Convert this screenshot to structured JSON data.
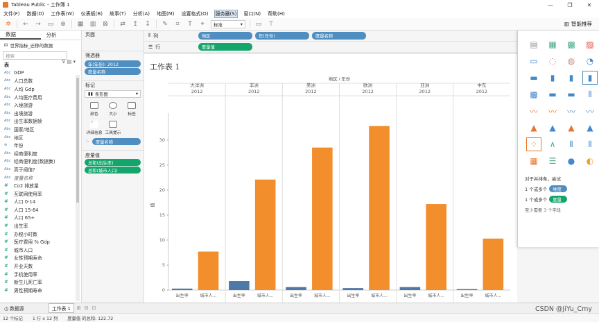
{
  "window": {
    "title": "Tableau Public - 工作簿 1",
    "controls": [
      "—",
      "❐",
      "✕"
    ]
  },
  "menu": [
    "文件(F)",
    "数据(D)",
    "工作表(W)",
    "仪表板(B)",
    "故事(T)",
    "分析(A)",
    "地图(M)",
    "设置格式(O)",
    "服务器(S)",
    "窗口(N)",
    "帮助(H)"
  ],
  "menu_active_index": 8,
  "toolbar": {
    "fit_select": "标准",
    "smart_label": "智能推荐"
  },
  "left_panel": {
    "tab_data": "数据",
    "tab_analysis": "分析",
    "datasource": "世界指标_迁移的数据",
    "search_placeholder": "搜索",
    "section_label": "表",
    "fields": [
      {
        "type": "Abc",
        "name": "GDP"
      },
      {
        "type": "Abc",
        "name": "人口总数"
      },
      {
        "type": "Abc",
        "name": "人均 Gdp"
      },
      {
        "type": "Abc",
        "name": "人均医疗费用"
      },
      {
        "type": "Abc",
        "name": "入境旅游"
      },
      {
        "type": "Abc",
        "name": "出境旅游"
      },
      {
        "type": "Abc",
        "name": "出生率数据帧"
      },
      {
        "type": "Abc",
        "name": "国家/地区"
      },
      {
        "type": "Abc",
        "name": "地区"
      },
      {
        "type": "⊕",
        "name": "年份"
      },
      {
        "type": "Abc",
        "name": "经商便利度"
      },
      {
        "type": "Abc",
        "name": "经商便利度(数据集)"
      },
      {
        "type": "Abc",
        "name": "高于阈值?"
      },
      {
        "type": "Abc",
        "name": "度量名称",
        "italic": true
      },
      {
        "type": "#",
        "name": "Co2 排放量"
      },
      {
        "type": "#",
        "name": "互联网使用率"
      },
      {
        "type": "#",
        "name": "人口 0-14"
      },
      {
        "type": "#",
        "name": "人口 15-64"
      },
      {
        "type": "#",
        "name": "人口 65+"
      },
      {
        "type": "#",
        "name": "出生率"
      },
      {
        "type": "#",
        "name": "办税小时数"
      },
      {
        "type": "#",
        "name": "医疗费用 % Gdp"
      },
      {
        "type": "#",
        "name": "城市人口"
      },
      {
        "type": "#",
        "name": "女性预期寿命"
      },
      {
        "type": "#",
        "name": "开业天数"
      },
      {
        "type": "#",
        "name": "手机使用率"
      },
      {
        "type": "#",
        "name": "新生儿死亡率"
      },
      {
        "type": "#",
        "name": "男性预期寿命"
      }
    ]
  },
  "cards": {
    "pages_title": "页面",
    "filters_title": "筛选器",
    "filters": [
      "年(年份): 2012",
      "度量名称"
    ],
    "marks_title": "标记",
    "marks_type": "条形图",
    "marks_buttons": [
      "颜色",
      "大小",
      "标签",
      "详细信息",
      "工具提示"
    ],
    "marks_pill": "度量名称",
    "measures_title": "度量值",
    "measures": [
      "总和(出生率)",
      "总和(城市人口)"
    ]
  },
  "shelves": {
    "columns_label": "列",
    "rows_label": "行",
    "columns": [
      "地区",
      "年(年份)",
      "度量名称"
    ],
    "rows": [
      "度量值"
    ]
  },
  "sheet": {
    "title": "工作表 1",
    "header_title": "地区 / 年份",
    "y_axis_label": "值"
  },
  "chart_data": {
    "type": "bar",
    "regions": [
      "大洋洲",
      "非洲",
      "美洲",
      "欧洲",
      "亚洲",
      "中东"
    ],
    "year": "2012",
    "categories": [
      "出生率",
      "城市人..."
    ],
    "series": [
      {
        "name": "出生率",
        "color": "#4e79a7",
        "values": [
          0.3,
          1.8,
          0.6,
          0.4,
          0.6,
          0.2
        ]
      },
      {
        "name": "城市人口",
        "color": "#f28e2b",
        "values": [
          7.7,
          22.1,
          28.5,
          32.8,
          17.2,
          10.3
        ]
      }
    ],
    "yticks": [
      0,
      5,
      10,
      15,
      20,
      25,
      30
    ],
    "ylim": [
      0,
      34
    ]
  },
  "smart_panel": {
    "hint": "对于并排条，尝试",
    "row1_prefix": "1 个或多个",
    "row1_pill": "维度",
    "row2_prefix": "1 个或多个",
    "row2_pill": "度量",
    "min_note": "至少需要 3 个字段"
  },
  "bottom": {
    "datasource_tab": "数据源",
    "sheet_tab": "工作表 1",
    "status_marks": "12 个标记",
    "status_dims": "1 行 x 12 列",
    "status_sum": "度量值 的总和: 122.72",
    "watermark": "CSDN @JiYu_Cmy"
  }
}
